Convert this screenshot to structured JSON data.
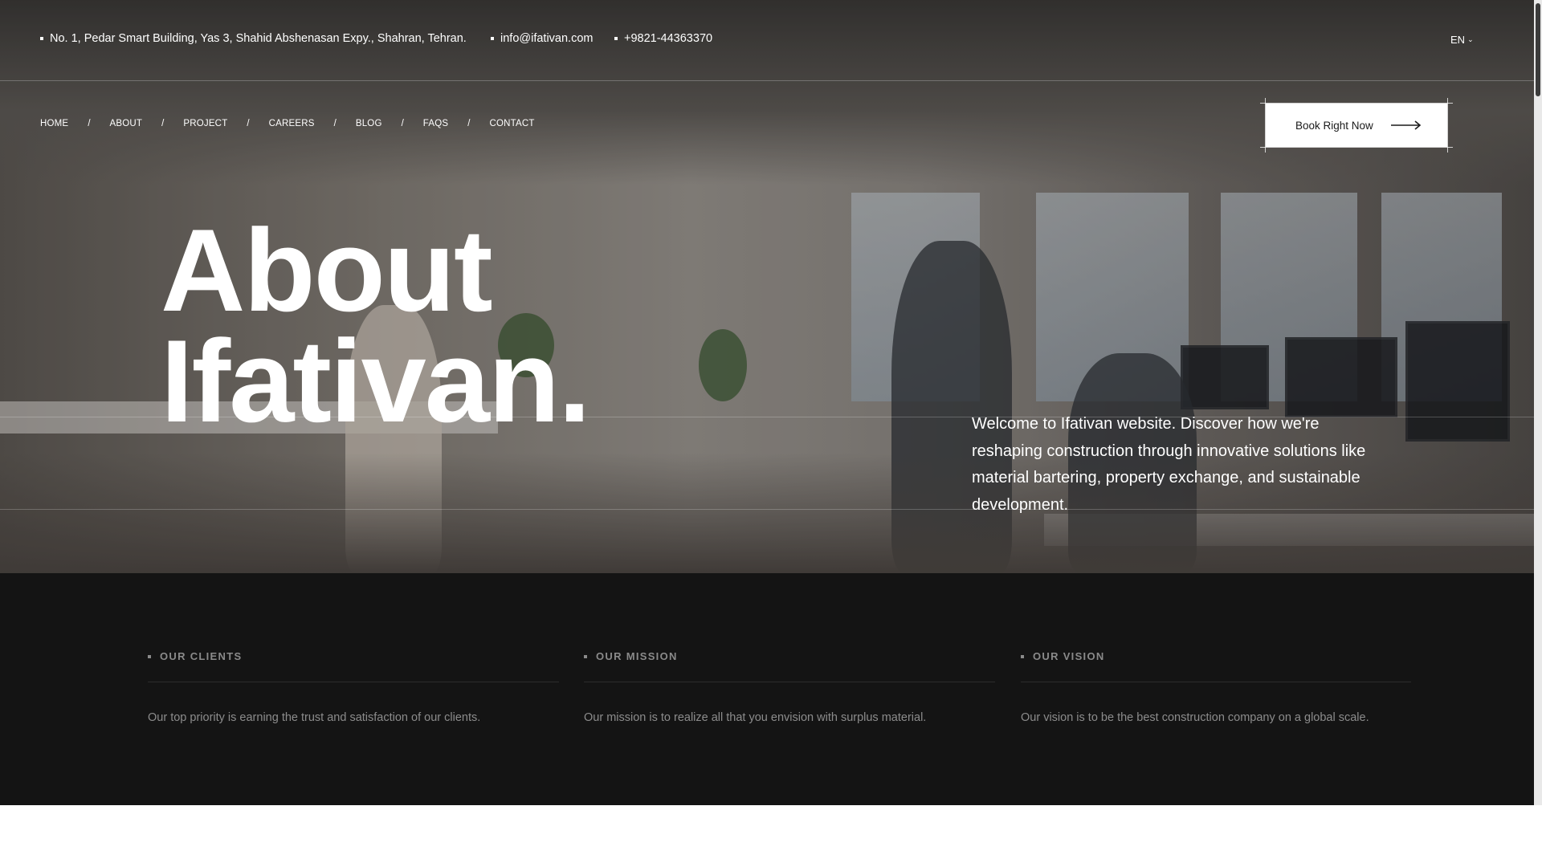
{
  "topbar": {
    "address": "No. 1, Pedar Smart Building, Yas 3, Shahid Abshenasan Expy., Shahran, Tehran.",
    "email": "info@ifativan.com",
    "phone": "+9821-44363370",
    "language": "EN"
  },
  "nav": {
    "items": [
      "HOME",
      "ABOUT",
      "PROJECT",
      "CAREERS",
      "BLOG",
      "FAQS",
      "CONTACT"
    ],
    "separator": "/"
  },
  "cta": {
    "label": "Book Right Now",
    "icon": "long-arrow-right-icon"
  },
  "hero": {
    "title_line1": "About",
    "title_line2": "Ifativan.",
    "text": "Welcome to Ifativan website. Discover how we're reshaping construction through innovative solutions like material bartering, property exchange, and sustainable development."
  },
  "features": [
    {
      "title": "OUR CLIENTS",
      "text": "Our top priority is earning the trust and satisfaction of our clients."
    },
    {
      "title": "OUR MISSION",
      "text": "Our mission is to realize all that you envision with surplus material."
    },
    {
      "title": "OUR VISION",
      "text": "Our vision is to be the best construction company on a global scale."
    }
  ],
  "colors": {
    "dark_section": "#141414",
    "hero_text": "#ffffff",
    "muted_text": "#8a8a8a"
  }
}
